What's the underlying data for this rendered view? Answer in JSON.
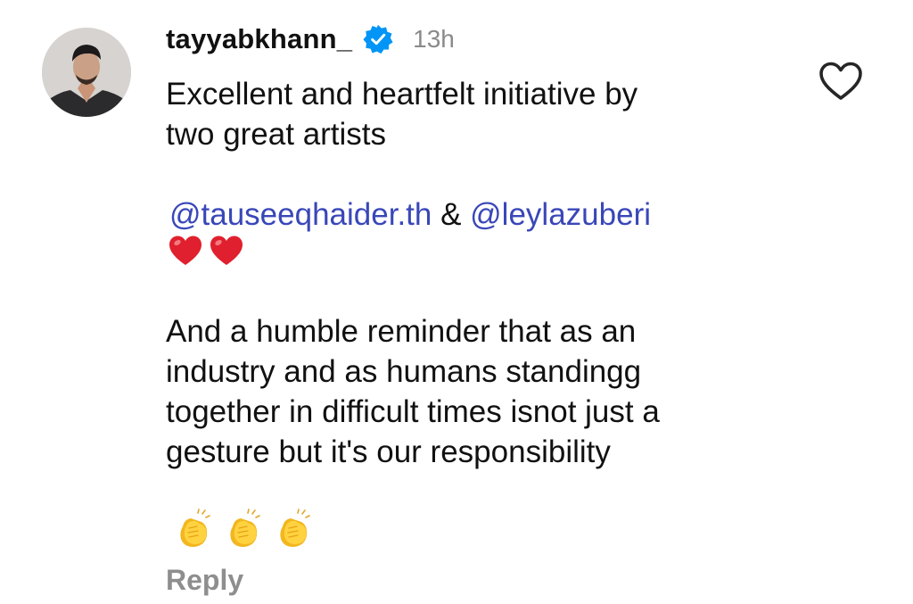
{
  "comment": {
    "username": "tayyabkhann_",
    "timestamp": "13h",
    "verified": true,
    "paragraph1": [
      "Excellent and heartfelt initiative by",
      "two great artists"
    ],
    "mention1": "@tauseeqhaider.th",
    "separator": " & ",
    "mention2": "@leylazuberi",
    "paragraph2": [
      "And a humble reminder that as an",
      "industry and as humans standingg",
      "together in difficult times isnot just a",
      "gesture but it's our responsibility"
    ],
    "reply_label": "Reply",
    "icons": {
      "verified": "verified-badge-icon",
      "like": "heart-outline-icon",
      "hearts": [
        "red-heart-emoji",
        "red-heart-emoji"
      ],
      "claps": [
        "clapping-hands-emoji",
        "clapping-hands-emoji",
        "clapping-hands-emoji"
      ]
    }
  },
  "colors": {
    "mention": "#3947b8",
    "verified": "#0095f6",
    "muted": "#8e8e8e",
    "heart": "#e0202e",
    "clap": "#f6c32c"
  }
}
